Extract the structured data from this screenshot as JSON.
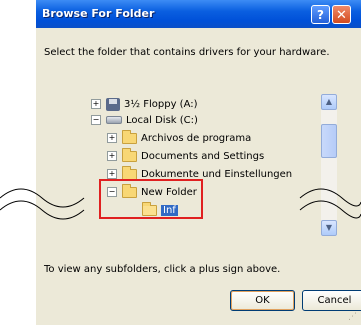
{
  "window": {
    "title": "Browse For Folder",
    "help_button": "?",
    "close_button": "✕"
  },
  "instruction": "Select the folder that contains drivers for your hardware.",
  "tree": {
    "items": [
      {
        "label": "3½ Floppy (A:)",
        "expander": "+",
        "icon": "floppy-disk-icon"
      },
      {
        "label": "Local Disk (C:)",
        "expander": "−",
        "icon": "hard-drive-icon"
      },
      {
        "label": "Archivos de programa",
        "expander": "+",
        "icon": "folder-icon"
      },
      {
        "label": "Documents and Settings",
        "expander": "+",
        "icon": "folder-icon"
      },
      {
        "label": "Dokumente und Einstellungen",
        "expander": "+",
        "icon": "folder-icon"
      },
      {
        "label": "New Folder",
        "expander": "−",
        "icon": "folder-icon"
      },
      {
        "label": "Inf",
        "expander": "",
        "icon": "open-folder-icon",
        "selected": true
      }
    ]
  },
  "scroll": {
    "up": "▲",
    "down": "▼"
  },
  "hint": "To view any subfolders, click a plus sign above.",
  "buttons": {
    "ok": "OK",
    "cancel": "Cancel"
  },
  "colors": {
    "selection": "#316ac5",
    "highlight_border": "#e02020",
    "titlebar": "#0a5fe0"
  }
}
